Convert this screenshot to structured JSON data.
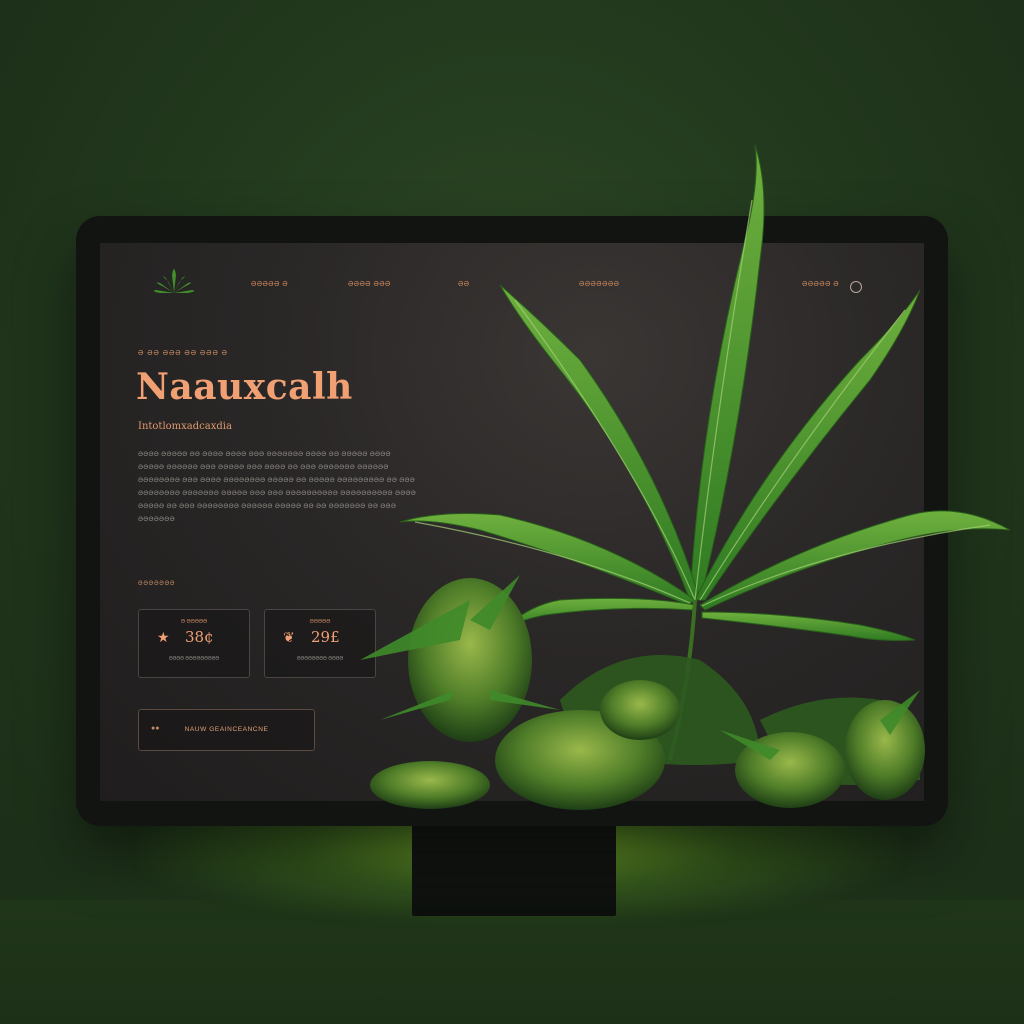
{
  "nav": {
    "logo_icon": "cannabis-leaf-icon",
    "items": [
      "ƏƏƏƏƏ Ə",
      "ƏƏƏƏ ƏƏƏ",
      "ƏƏ",
      "ƏƏƏƏƏƏƏ",
      "ƏƏƏƏƏ Ə"
    ],
    "search_icon": "search-icon"
  },
  "hero": {
    "eyebrow": "Ə ƏƏ ƏƏƏ ƏƏ ƏƏƏ Ə",
    "title": "Naauxcalh",
    "subtitle": "Intotlomxadcaxdia",
    "body": "ƏƏƏƏ ƏƏƏƏƏ ƏƏ ƏƏƏƏ ƏƏƏƏ ƏƏƏ ƏƏƏƏƏƏƏ ƏƏƏƏ ƏƏ ƏƏƏƏƏ ƏƏƏƏ ƏƏƏƏƏ ƏƏƏƏƏƏ ƏƏƏ ƏƏƏƏƏ ƏƏƏ ƏƏƏƏ ƏƏ ƏƏƏ ƏƏƏƏƏƏƏ ƏƏƏƏƏƏ ƏƏƏƏƏƏƏƏ ƏƏƏ ƏƏƏƏ ƏƏƏƏƏƏƏƏ ƏƏƏƏƏ ƏƏ ƏƏƏƏƏ ƏƏƏƏƏƏƏƏƏ ƏƏ ƏƏƏ ƏƏƏƏƏƏƏƏ ƏƏƏƏƏƏƏ ƏƏƏƏƏ ƏƏƏ ƏƏƏ ƏƏƏƏƏƏƏƏƏƏ ƏƏƏƏƏƏƏƏƏƏ ƏƏƏƏ ƏƏƏƏƏ ƏƏ ƏƏƏ ƏƏƏƏƏƏƏƏ ƏƏƏƏƏƏ ƏƏƏƏƏ ƏƏ ƏƏ ƏƏƏƏƏƏƏ ƏƏ ƏƏƏ ƏƏƏƏƏƏƏ"
  },
  "stats": {
    "section_label": "ƏƏƏƏƏƏƏ",
    "cards": [
      {
        "label": "Ə ƏƏƏƏƏ",
        "icon": "star-icon",
        "value": "38¢",
        "caption": "ƏƏƏƏ ƏƏƏƏƏƏƏƏƏ"
      },
      {
        "label": "ƏƏƏƏƏ",
        "icon": "leaf-icon",
        "value": "29£",
        "caption": "ƏƏƏƏƏƏƏƏ ƏƏƏƏ"
      }
    ]
  },
  "cta": {
    "label": "NAUW GEAINCEANCNE",
    "icon": "arrow-icon"
  },
  "colors": {
    "accent": "#f0a073",
    "screen_bg": "#2a2727",
    "leaf_green": "#3f8f2a",
    "backdrop": "#233a1e"
  }
}
